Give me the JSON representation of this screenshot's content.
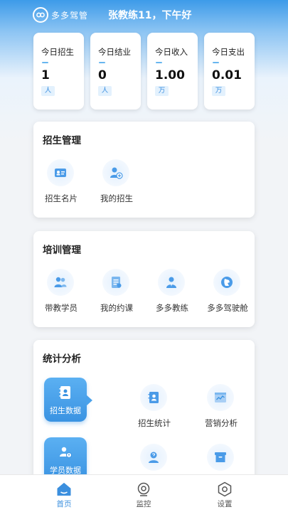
{
  "header": {
    "logo_text": "多多驾管",
    "greeting": "张教练11，下午好"
  },
  "stats": [
    {
      "title": "今日招生",
      "value": "1",
      "unit": "人"
    },
    {
      "title": "今日结业",
      "value": "0",
      "unit": "人"
    },
    {
      "title": "今日收入",
      "value": "1.00",
      "unit": "万"
    },
    {
      "title": "今日支出",
      "value": "0.01",
      "unit": "万"
    }
  ],
  "enrollment": {
    "title": "招生管理",
    "items": [
      {
        "label": "招生名片",
        "icon": "id-card-icon"
      },
      {
        "label": "我的招生",
        "icon": "add-user-icon"
      }
    ]
  },
  "training": {
    "title": "培训管理",
    "items": [
      {
        "label": "带教学员",
        "icon": "students-icon"
      },
      {
        "label": "我的约课",
        "icon": "booking-icon"
      },
      {
        "label": "多多教练",
        "icon": "coach-icon"
      },
      {
        "label": "多多驾驶舱",
        "icon": "cockpit-icon"
      }
    ]
  },
  "analytics": {
    "title": "统计分析",
    "side_tabs": [
      {
        "label": "招生数据",
        "icon": "contacts-icon"
      },
      {
        "label": "学员数据",
        "icon": "student-data-icon"
      }
    ],
    "items": [
      {
        "label": "招生统计",
        "icon": "contacts-stat-icon"
      },
      {
        "label": "营销分析",
        "icon": "marketing-chart-icon"
      },
      {
        "label": "",
        "icon": "question-user-icon"
      },
      {
        "label": "",
        "icon": "archive-box-icon"
      }
    ]
  },
  "nav": {
    "items": [
      {
        "label": "首页",
        "icon": "home-icon",
        "active": true
      },
      {
        "label": "监控",
        "icon": "monitor-icon",
        "active": false
      },
      {
        "label": "设置",
        "icon": "settings-icon",
        "active": false
      }
    ]
  },
  "colors": {
    "primary": "#3b8fde",
    "accent_light": "#e3f1fd",
    "header_gradient_top": "#3d9be9"
  }
}
